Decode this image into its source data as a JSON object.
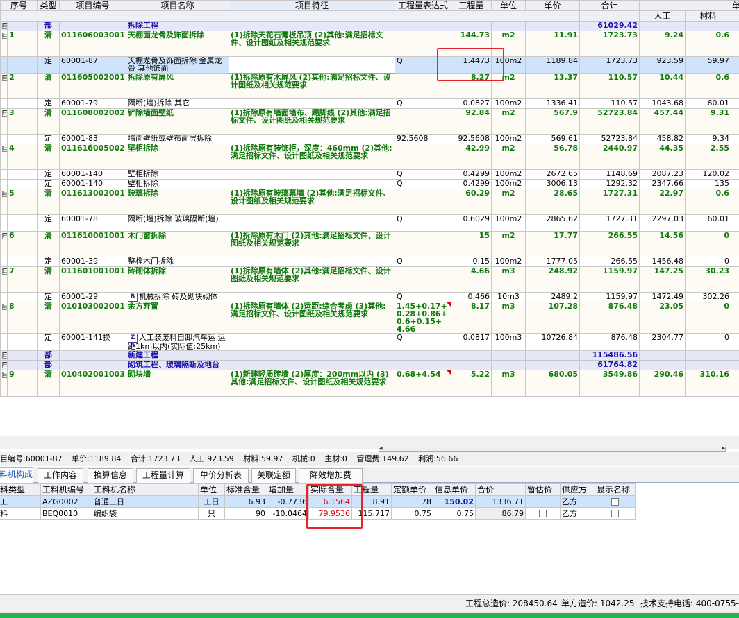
{
  "grid": {
    "headers": [
      "序号",
      "类型",
      "项目编号",
      "项目名称",
      "项目特征",
      "工程量表达式",
      "工程量",
      "单位",
      "单价",
      "合计",
      "单价"
    ],
    "subheaders": [
      "人工",
      "材料"
    ],
    "rows": [
      {
        "cls": "bu",
        "toggle": "⊟",
        "idx": "",
        "typ": "部",
        "code": "",
        "name": "拆除工程",
        "feat": "",
        "expr": "",
        "qty": "",
        "unit": "",
        "price": "",
        "total": "61029.42",
        "lab": "",
        "mat": ""
      },
      {
        "cls": "qd",
        "toggle": "⊟",
        "idx": "1",
        "typ": "清",
        "code": "011606003001",
        "name": "天棚面龙骨及饰面拆除",
        "feat": "(1)拆除天花石膏板吊顶\n(2)其他:满足招标文件、设计图纸及相关规范要求",
        "expr": "",
        "qty": "144.73",
        "unit": "m2",
        "price": "11.91",
        "total": "1723.73",
        "lab": "9.24",
        "mat": "0.6"
      },
      {
        "cls": "de sel",
        "toggle": "",
        "idx": "",
        "typ": "定",
        "code": "60001-87",
        "name": "天棚龙骨及饰面拆除 金属龙骨 其他饰面",
        "feat": "",
        "expr": "Q",
        "qty": "1.4473",
        "unit": "100m2",
        "price": "1189.84",
        "total": "1723.73",
        "lab": "923.59",
        "mat": "59.97"
      },
      {
        "cls": "qd",
        "toggle": "⊟",
        "idx": "2",
        "typ": "清",
        "code": "011605002001",
        "name": "拆除原有屏风",
        "feat": "(1)拆除原有木屏风\n(2)其他:满足招标文件、设计图纸及相关规范要求",
        "expr": "",
        "qty": "8.27",
        "unit": "m2",
        "price": "13.37",
        "total": "110.57",
        "lab": "10.44",
        "mat": "0.6"
      },
      {
        "cls": "de",
        "toggle": "",
        "idx": "",
        "typ": "定",
        "code": "60001-79",
        "name": "隔断(墙)拆除 其它",
        "feat": "",
        "expr": "Q",
        "qty": "0.0827",
        "unit": "100m2",
        "price": "1336.41",
        "total": "110.57",
        "lab": "1043.68",
        "mat": "60.01"
      },
      {
        "cls": "qd",
        "toggle": "⊟",
        "idx": "3",
        "typ": "清",
        "code": "011608002002",
        "name": "铲除墙面壁纸",
        "feat": "(1)拆除原有墙面墙布、踢脚线\n(2)其他:满足招标文件、设计图纸及相关规范要求",
        "expr": "",
        "qty": "92.84",
        "unit": "m2",
        "price": "567.9",
        "total": "52723.84",
        "lab": "457.44",
        "mat": "9.31"
      },
      {
        "cls": "de",
        "toggle": "",
        "idx": "",
        "typ": "定",
        "code": "60001-83",
        "name": "墙面壁纸或壁布面层拆除",
        "feat": "",
        "expr": "92.5608",
        "qty": "92.5608",
        "unit": "100m2",
        "price": "569.61",
        "total": "52723.84",
        "lab": "458.82",
        "mat": "9.34"
      },
      {
        "cls": "qd",
        "toggle": "⊟",
        "idx": "4",
        "typ": "清",
        "code": "01161б005002",
        "name": "壁柜拆除",
        "feat": "(1)拆除原有装饰柜，深度：460mm\n(2)其他:满足招标文件、设计图纸及相关规范要求",
        "expr": "",
        "qty": "42.99",
        "unit": "m2",
        "price": "56.78",
        "total": "2440.97",
        "lab": "44.35",
        "mat": "2.55"
      },
      {
        "cls": "de",
        "toggle": "",
        "idx": "",
        "typ": "定",
        "code": "60001-140",
        "name": "壁柜拆除",
        "feat": "",
        "expr": "Q",
        "qty": "0.4299",
        "unit": "100m2",
        "price": "2672.65",
        "total": "1148.69",
        "lab": "2087.23",
        "mat": "120.02"
      },
      {
        "cls": "de",
        "toggle": "",
        "idx": "",
        "typ": "定",
        "code": "60001-140",
        "name": "壁柜拆除",
        "feat": "",
        "expr": "Q",
        "qty": "0.4299",
        "unit": "100m2",
        "price": "3006.13",
        "total": "1292.32",
        "lab": "2347.66",
        "mat": "135"
      },
      {
        "cls": "qd",
        "toggle": "⊟",
        "idx": "5",
        "typ": "清",
        "code": "011613002001",
        "name": "玻璃拆除",
        "feat": "(1)拆除原有玻璃幕墙\n(2)其他:满足招标文件、设计图纸及相关规范要求",
        "expr": "",
        "qty": "60.29",
        "unit": "m2",
        "price": "28.65",
        "total": "1727.31",
        "lab": "22.97",
        "mat": "0.6"
      },
      {
        "cls": "de",
        "toggle": "",
        "idx": "",
        "typ": "定",
        "code": "60001-78",
        "name": "隔断(墙)拆除 玻璃隔断(墙)",
        "feat": "",
        "expr": "Q",
        "qty": "0.6029",
        "unit": "100m2",
        "price": "2865.62",
        "total": "1727.31",
        "lab": "2297.03",
        "mat": "60.01"
      },
      {
        "cls": "qd",
        "toggle": "⊟",
        "idx": "6",
        "typ": "清",
        "code": "011610001001",
        "name": "木门窗拆除",
        "feat": "(1)拆除原有木门\n(2)其他:满足招标文件、设计图纸及相关规范要求",
        "expr": "",
        "qty": "15",
        "unit": "m2",
        "price": "17.77",
        "total": "266.55",
        "lab": "14.56",
        "mat": "0"
      },
      {
        "cls": "de",
        "toggle": "",
        "idx": "",
        "typ": "定",
        "code": "60001-39",
        "name": "整樘木门拆除",
        "feat": "",
        "expr": "Q",
        "qty": "0.15",
        "unit": "100m2",
        "price": "1777.05",
        "total": "266.55",
        "lab": "1456.48",
        "mat": "0"
      },
      {
        "cls": "qd",
        "toggle": "⊟",
        "idx": "7",
        "typ": "清",
        "code": "011601001001",
        "name": "砖砌体拆除",
        "feat": "(1)拆除原有墙体\n(2)其他:满足招标文件、设计图纸及相关规范要求",
        "expr": "",
        "qty": "4.66",
        "unit": "m3",
        "price": "248.92",
        "total": "1159.97",
        "lab": "147.25",
        "mat": "30.23"
      },
      {
        "cls": "de",
        "toggle": "",
        "idx": "",
        "typ": "定",
        "code": "60001-29",
        "badge": "Bz",
        "name": "机械拆除 砖及砌块砌体",
        "feat": "",
        "expr": "Q",
        "qty": "0.466",
        "unit": "10m3",
        "price": "2489.2",
        "total": "1159.97",
        "lab": "1472.49",
        "mat": "302.26"
      },
      {
        "cls": "qd",
        "toggle": "⊟",
        "idx": "8",
        "typ": "清",
        "code": "010103002001",
        "name": "余方弃置",
        "feat": "(1)拆除原有墙体\n(2)运距:综合考虑\n(3)其他:满足招标文件、设计图纸及相关规范要求",
        "expr": "1.45+0.17+0.28+0.86+0.6+0.15+4.66",
        "exprTri": true,
        "qty": "8.17",
        "unit": "m3",
        "price": "107.28",
        "total": "876.48",
        "lab": "23.05",
        "mat": "0"
      },
      {
        "cls": "de",
        "toggle": "",
        "idx": "",
        "typ": "定",
        "code": "60001-141换",
        "badge": "Zh",
        "name": "人工装废料自卸汽车运 运距1km以内(实际值:25km)",
        "feat": "",
        "expr": "Q",
        "qty": "0.0817",
        "unit": "100m3",
        "price": "10726.84",
        "total": "876.48",
        "lab": "2304.77",
        "mat": "0"
      },
      {
        "cls": "bu",
        "toggle": "⊟",
        "idx": "",
        "typ": "部",
        "code": "",
        "name": "新建工程",
        "feat": "",
        "expr": "",
        "qty": "",
        "unit": "",
        "price": "",
        "total": "115486.56",
        "lab": "",
        "mat": ""
      },
      {
        "cls": "bu",
        "toggle": "⊟",
        "idx": "",
        "typ": "部",
        "code": "",
        "name": "砌筑工程、玻璃隔断及地台",
        "feat": "",
        "expr": "",
        "qty": "",
        "unit": "",
        "price": "",
        "total": "61764.82",
        "lab": "",
        "mat": ""
      },
      {
        "cls": "qd",
        "toggle": "⊟",
        "idx": "9",
        "typ": "清",
        "code": "010402001003",
        "name": "砌块墙",
        "feat": "(1)新建轻质砖墙\n(2)厚度：200mm以内\n(3)其他:满足招标文件、设计图纸及相关规范要求",
        "expr": "0.68+4.54",
        "exprTri": true,
        "qty": "5.22",
        "unit": "m3",
        "price": "680.05",
        "total": "3549.86",
        "lab": "290.46",
        "mat": "310.16"
      }
    ]
  },
  "info_bar": {
    "code": "目编号:60001-87",
    "price": "单价:1189.84",
    "total": "合计:1723.73",
    "labor": "人工:923.59",
    "material": "材料:59.97",
    "machine": "机械:0",
    "main_mat": "主材:0",
    "mgmt": "管理费:149.62",
    "profit": "利润:56.66"
  },
  "tabs": [
    "料机构成",
    "工作内容",
    "换算信息",
    "工程量计算",
    "单价分析表",
    "关联定额",
    "降效增加费"
  ],
  "sub_table": {
    "headers": [
      "料类型",
      "工料机编号",
      "工料机名称",
      "单位",
      "标准含量",
      "增加量",
      "实际含量",
      "工程量",
      "定额单价",
      "信息单价",
      "合价",
      "暂估价",
      "供应方",
      "显示名称"
    ],
    "rows": [
      {
        "type": "工",
        "code": "AZG0002",
        "name": "普通工日",
        "unit": "工日",
        "std": "6.93",
        "add": "-0.7736",
        "actual": "6.1564",
        "qty": "8.91",
        "dprice": "78",
        "iprice": "150.02",
        "sum": "1336.71",
        "supplier": "乙方"
      },
      {
        "type": "料",
        "code": "BEQ0010",
        "name": "编织袋",
        "unit": "只",
        "std": "90",
        "add": "-10.0464",
        "actual": "79.9536",
        "qty": "115.717",
        "dprice": "0.75",
        "iprice": "0.75",
        "sum": "86.79",
        "supplier": "乙方"
      }
    ]
  },
  "status": {
    "total_cost": "工程总造价: 208450.64",
    "unit_cost": "单方造价: 1042.25",
    "support": "技术支持电话: 400-0755-"
  },
  "colors": {
    "highlight": "#e8222f",
    "list_green": "#107a10",
    "section_blue": "#1a12b0",
    "selected_row": "#cfe4fb"
  }
}
